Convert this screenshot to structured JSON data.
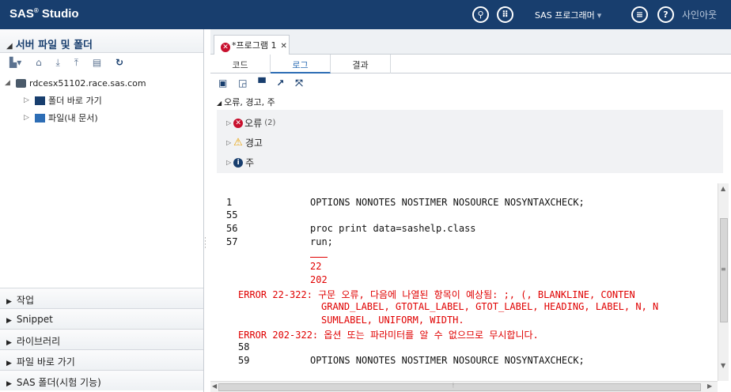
{
  "app": {
    "brand": "SAS",
    "brand_mark": "®",
    "brand_suffix": " Studio",
    "role_menu": "SAS 프로그래머",
    "role_caret": "▾",
    "signout": "사인아웃"
  },
  "topbar_icons": [
    "search-icon",
    "grid-menu-icon",
    "list-menu-icon",
    "help-icon"
  ],
  "sidebar": {
    "files_header": "서버 파일 및 폴더",
    "toolbar_icons": [
      "new-icon",
      "delete-icon",
      "download-icon",
      "upload-icon",
      "properties-icon",
      "refresh-icon"
    ],
    "server": "rdcesx51102.race.sas.com",
    "items": [
      {
        "label": "폴더 바로 가기"
      },
      {
        "label": "파일(내 문서)"
      }
    ],
    "sections": [
      {
        "label": "작업"
      },
      {
        "label": "Snippet"
      },
      {
        "label": "라이브러리"
      },
      {
        "label": "파일 바로 가기"
      },
      {
        "label": "SAS 폴더(시험 기능)"
      }
    ]
  },
  "editor": {
    "tab_label": "*프로그램 1",
    "subtabs": [
      "코드",
      "로그",
      "결과"
    ],
    "active_subtab": "로그",
    "log_toolbar_icons": [
      "save-icon",
      "open-html-icon",
      "print-icon",
      "popout-icon",
      "maximize-icon"
    ],
    "summary_title": "오류, 경고, 주",
    "errors_label": "오류",
    "errors_count": "(2)",
    "warnings_label": "경고",
    "notes_label": "주"
  },
  "log": {
    "lines": [
      {
        "num": "1",
        "text": "OPTIONS NONOTES NOSTIMER NOSOURCE NOSYNTAXCHECK;",
        "kind": "src"
      },
      {
        "num": "55",
        "text": "",
        "kind": "src"
      },
      {
        "num": "56",
        "text": "proc print data=sashelp.class",
        "kind": "src"
      },
      {
        "num": "57",
        "text": "run;",
        "kind": "src"
      },
      {
        "num": "",
        "text": "22",
        "kind": "red"
      },
      {
        "num": "",
        "text": "202",
        "kind": "red"
      },
      {
        "num": "",
        "text": "ERROR 22-322: 구문 오류, 다음에 나열된 항목이 예상됨: ;, (, BLANKLINE, CONTEN",
        "kind": "red"
      },
      {
        "num": "",
        "text": "GRAND_LABEL, GTOTAL_LABEL, GTOT_LABEL, HEADING, LABEL, N, N",
        "kind": "red"
      },
      {
        "num": "",
        "text": "SUMLABEL, UNIFORM, WIDTH.",
        "kind": "red"
      },
      {
        "num": "",
        "text": "ERROR 202-322: 옵션 또는 파라미터를 알 수 없으므로 무시합니다.",
        "kind": "red"
      },
      {
        "num": "58",
        "text": "",
        "kind": "src"
      },
      {
        "num": "59",
        "text": "OPTIONS NONOTES NOSTIMER NOSOURCE NOSYNTAXCHECK;",
        "kind": "src"
      }
    ]
  }
}
